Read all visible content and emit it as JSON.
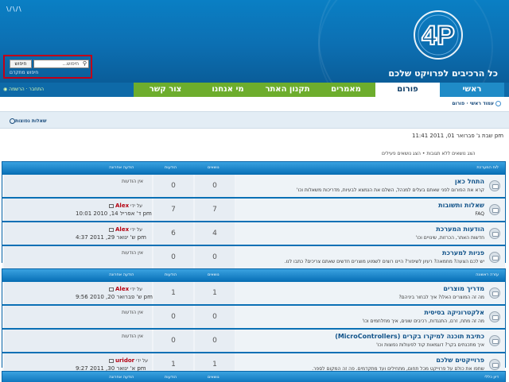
{
  "header": {
    "topmark": "\\/\\/\\",
    "logo_text": "4P",
    "slogan": "כל הרכיבים לפרויקט שלכם"
  },
  "search": {
    "button_label": "חיפוש",
    "placeholder": "חיפוש...",
    "advanced_label": "חיפוש מתקדם"
  },
  "nav": {
    "tabs": [
      {
        "label": "ראשי"
      },
      {
        "label": "פורום"
      },
      {
        "label": "מאמרים"
      },
      {
        "label": "תקנון האתר"
      },
      {
        "label": "מי אנחנו"
      },
      {
        "label": "צור קשר"
      }
    ],
    "util_text": "התחבר · הרשמה"
  },
  "breadcrumb": "עמוד ראשי · פורום",
  "new_posts_label": "שאלות נפוצות",
  "datetime": "שבת ג' פברואר 01, 2011 11:41 pm",
  "view_links": "הצג נושאים ללא תגובות • הצג נושאים פעילים",
  "colors": {
    "header_blue": "#0a6fb2",
    "nav_green": "#6dad2d",
    "link_blue": "#105289",
    "user_red": "#b50010"
  },
  "categories": [
    {
      "headers": {
        "forum": "לוח המערכת",
        "topics": "נושאים",
        "posts": "הודעות",
        "last": "הודעה אחרונה"
      },
      "forums": [
        {
          "title": "התחל כאן",
          "desc": "קרא את הפורום לפני שאתם בעלים למנהל, השלם את הנמצא לבעיות, מדריכות משאלות וכו'",
          "topics": "0",
          "posts": "0",
          "no_posts": "אין הודעות",
          "by": "",
          "user": "",
          "date": ""
        },
        {
          "title": "שאלות ותשובות",
          "desc": "FAQ",
          "topics": "7",
          "posts": "7",
          "no_posts": "",
          "by": "על ידי",
          "user": "Alex",
          "date": "ד' אפריל 14, 2010 10:01 pm"
        },
        {
          "title": "הודעות המערכת",
          "desc": "חדשות האתר, הכרזות, שינויים וכו'",
          "topics": "4",
          "posts": "6",
          "no_posts": "",
          "by": "על ידי",
          "user": "Alex",
          "date": "ש' ינואר 29, 2011 4:37 pm"
        },
        {
          "title": "פניות למערכת",
          "desc": "יש לכם הצעה? מחמאה? רעיון לשיפור? היינו רוצים לשמוע מוצרים חדשים שאתם צריכים? כתבו לנו.",
          "topics": "0",
          "posts": "0",
          "no_posts": "אין הודעות",
          "by": "",
          "user": "",
          "date": ""
        }
      ]
    },
    {
      "headers": {
        "forum": "עזרה ראשונה",
        "topics": "נושאים",
        "posts": "הודעות",
        "last": "הודעה אחרונה"
      },
      "forums": [
        {
          "title": "מדריך מוצרים",
          "desc": "מה זה המוצרים האלו? איך לבחור ביניהם?",
          "topics": "1",
          "posts": "1",
          "no_posts": "",
          "by": "על ידי",
          "user": "Alex",
          "date": "ש' פברואר 20, 2010 9:56 pm"
        },
        {
          "title": "אלקטרוניקה בסיסית",
          "desc": "מה זה מתח, זרם, התנגדות, רכיבים שונים, איך מחלחמים וכו'",
          "topics": "0",
          "posts": "0",
          "no_posts": "אין הודעות",
          "by": "",
          "user": "",
          "date": ""
        },
        {
          "title": "כתיבת תוכנה למיקרו בקרים (MicroControllers)",
          "desc": "איך מתכנתים בקר? דוגמאות קוד לפעולות נפוצות וכו'",
          "topics": "0",
          "posts": "0",
          "no_posts": "אין הודעות",
          "by": "",
          "user": "",
          "date": ""
        },
        {
          "title": "פרוייקטים שלכם",
          "desc": "שתפו את כולם על פרוייקט מכל תחום, מתחילים ועד מתקדמים. פה זה המקום לספר.",
          "topics": "1",
          "posts": "1",
          "no_posts": "",
          "by": "על ידי",
          "user": "uridor",
          "date": "א' ינואר 30, 2011 9:27 pm"
        }
      ]
    },
    {
      "headers": {
        "forum": "דיון כללי",
        "topics": "נושאים",
        "posts": "הודעות",
        "last": "הודעה אחרונה"
      },
      "forums": []
    }
  ]
}
